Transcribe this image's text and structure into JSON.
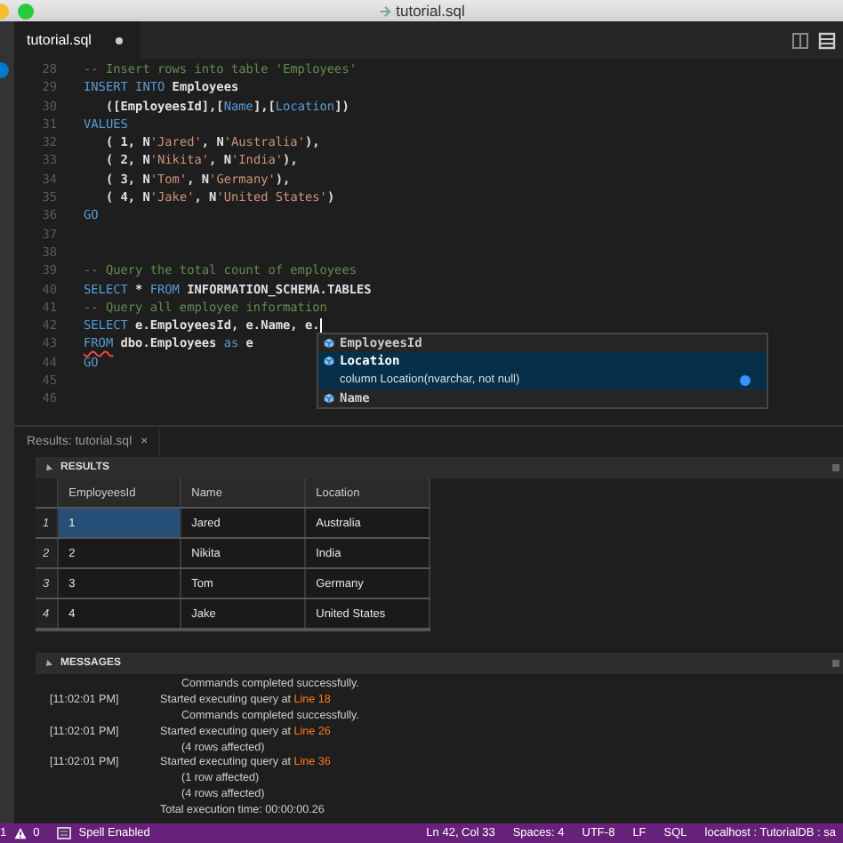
{
  "window": {
    "title": "tutorial.sql"
  },
  "tabs": [
    {
      "label": "tutorial.sql",
      "selected": true,
      "modified": true
    }
  ],
  "editor": {
    "lines": [
      {
        "number": "28",
        "tokens": [
          {
            "kind": "comment",
            "text": "-- Insert rows into table 'Employees'"
          }
        ]
      },
      {
        "number": "29",
        "tokens": [
          {
            "kind": "keyword",
            "text": "INSERT INTO"
          },
          {
            "kind": "plain",
            "text": " Employees"
          }
        ]
      },
      {
        "number": "30",
        "tokens": [
          {
            "kind": "plain",
            "text": "   ([EmployeesId],["
          },
          {
            "kind": "keyword",
            "text": "Name"
          },
          {
            "kind": "plain",
            "text": "],["
          },
          {
            "kind": "keyword",
            "text": "Location"
          },
          {
            "kind": "plain",
            "text": "])"
          }
        ]
      },
      {
        "number": "31",
        "tokens": [
          {
            "kind": "keyword",
            "text": "VALUES"
          }
        ]
      },
      {
        "number": "32",
        "tokens": [
          {
            "kind": "plain",
            "text": "   ( 1, N"
          },
          {
            "kind": "string",
            "text": "'Jared'"
          },
          {
            "kind": "plain",
            "text": ", N"
          },
          {
            "kind": "string",
            "text": "'Australia'"
          },
          {
            "kind": "plain",
            "text": "),"
          }
        ]
      },
      {
        "number": "33",
        "tokens": [
          {
            "kind": "plain",
            "text": "   ( 2, N"
          },
          {
            "kind": "string",
            "text": "'Nikita'"
          },
          {
            "kind": "plain",
            "text": ", N"
          },
          {
            "kind": "string",
            "text": "'India'"
          },
          {
            "kind": "plain",
            "text": "),"
          }
        ]
      },
      {
        "number": "34",
        "tokens": [
          {
            "kind": "plain",
            "text": "   ( 3, N"
          },
          {
            "kind": "string",
            "text": "'Tom'"
          },
          {
            "kind": "plain",
            "text": ", N"
          },
          {
            "kind": "string",
            "text": "'Germany'"
          },
          {
            "kind": "plain",
            "text": "),"
          }
        ]
      },
      {
        "number": "35",
        "tokens": [
          {
            "kind": "plain",
            "text": "   ( 4, N"
          },
          {
            "kind": "string",
            "text": "'Jake'"
          },
          {
            "kind": "plain",
            "text": ", N"
          },
          {
            "kind": "string",
            "text": "'United States'"
          },
          {
            "kind": "plain",
            "text": ")"
          }
        ]
      },
      {
        "number": "36",
        "tokens": [
          {
            "kind": "keyword",
            "text": "GO"
          }
        ]
      },
      {
        "number": "37"
      },
      {
        "number": "38"
      },
      {
        "number": "39",
        "tokens": [
          {
            "kind": "comment",
            "text": "-- Query the total count of employees"
          }
        ]
      },
      {
        "number": "40",
        "tokens": [
          {
            "kind": "keyword",
            "text": "SELECT"
          },
          {
            "kind": "plain",
            "text": " * "
          },
          {
            "kind": "keyword",
            "text": "FROM"
          },
          {
            "kind": "plain",
            "text": " INFORMATION_SCHEMA.TABLES"
          }
        ]
      },
      {
        "number": "41",
        "tokens": [
          {
            "kind": "comment",
            "text": "-- Query all employee information"
          }
        ]
      },
      {
        "number": "42",
        "cursor": true,
        "tokens": [
          {
            "kind": "keyword",
            "text": "SELECT"
          },
          {
            "kind": "plain",
            "text": " e.EmployeesId, e.Name, e."
          }
        ]
      },
      {
        "number": "43",
        "tokens": [
          {
            "kind": "error",
            "text": "FROM"
          },
          {
            "kind": "plain",
            "text": " dbo.Employees "
          },
          {
            "kind": "keyword",
            "text": "as"
          },
          {
            "kind": "plain",
            "text": " e"
          }
        ]
      },
      {
        "number": "44",
        "tokens": [
          {
            "kind": "keyword",
            "text": "GO"
          }
        ]
      },
      {
        "number": "45"
      },
      {
        "number": "46"
      }
    ]
  },
  "suggestions": [
    {
      "label": "EmployeesId",
      "selected": false
    },
    {
      "label": "Location",
      "selected": true,
      "detail": "column Location(nvarchar, not null)"
    },
    {
      "label": "Name",
      "selected": false
    }
  ],
  "results_tab": {
    "label": "Results: tutorial.sql",
    "close": "×"
  },
  "results": {
    "title": "RESULTS",
    "columns": [
      "EmployeesId",
      "Name",
      "Location"
    ],
    "rows": [
      {
        "number": "1",
        "cells": [
          {
            "text": "1",
            "selected": true
          },
          {
            "text": "Jared",
            "selected": false
          },
          {
            "text": "Australia",
            "selected": false
          }
        ]
      },
      {
        "number": "2",
        "cells": [
          {
            "text": "2",
            "selected": false
          },
          {
            "text": "Nikita",
            "selected": false
          },
          {
            "text": "India",
            "selected": false
          }
        ]
      },
      {
        "number": "3",
        "cells": [
          {
            "text": "3",
            "selected": false
          },
          {
            "text": "Tom",
            "selected": false
          },
          {
            "text": "Germany",
            "selected": false
          }
        ]
      },
      {
        "number": "4",
        "cells": [
          {
            "text": "4",
            "selected": false
          },
          {
            "text": "Jake",
            "selected": false
          },
          {
            "text": "United States",
            "selected": false
          }
        ]
      }
    ]
  },
  "messages": {
    "title": "MESSAGES",
    "lines": [
      {
        "kind": "status",
        "text": "Commands completed successfully."
      },
      {
        "kind": "start",
        "time": "[11:02:01 PM]",
        "text": "Started executing query at ",
        "link": "Line 18"
      },
      {
        "kind": "status",
        "text": "Commands completed successfully."
      },
      {
        "kind": "start",
        "time": "[11:02:01 PM]",
        "text": "Started executing query at ",
        "link": "Line 26"
      },
      {
        "kind": "status",
        "text": "(4 rows affected)"
      },
      {
        "kind": "start",
        "time": "[11:02:01 PM]",
        "text": "Started executing query at ",
        "link": "Line 36"
      },
      {
        "kind": "status",
        "text": "(1 row affected)"
      },
      {
        "kind": "status",
        "text": "(4 rows affected)"
      },
      {
        "kind": "start",
        "text": "Total execution time: 00:00:00.26"
      }
    ]
  },
  "status_bar": {
    "errors": "1",
    "warnings": "0",
    "spell": "Spell Enabled",
    "items": [
      "Ln 42, Col 33",
      "Spaces: 4",
      "UTF-8",
      "LF",
      "SQL",
      "localhost : TutorialDB : sa"
    ]
  }
}
